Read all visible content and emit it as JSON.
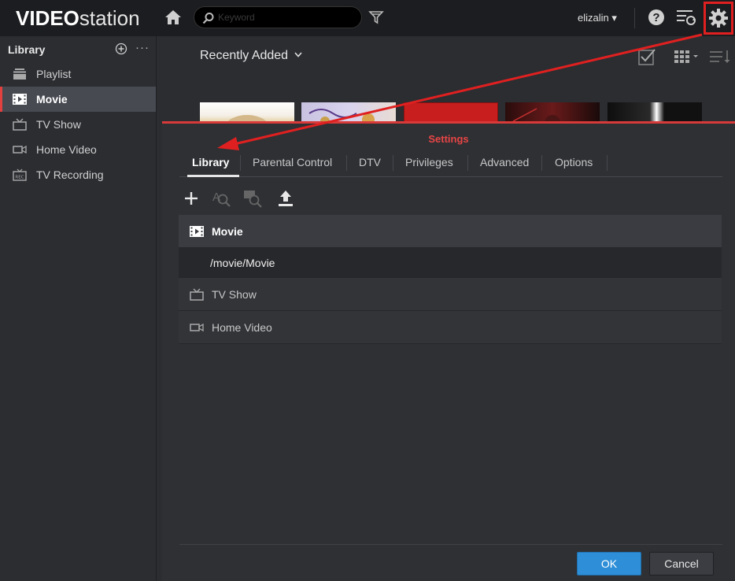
{
  "app": {
    "logo_bold": "VIDEO",
    "logo_light": "station"
  },
  "topbar": {
    "search_placeholder": "Keyword",
    "user": "elizalin ▾"
  },
  "sidebar": {
    "heading": "Library",
    "more": "···",
    "items": [
      {
        "label": "Playlist",
        "icon": "playlist-icon",
        "active": false
      },
      {
        "label": "Movie",
        "icon": "film-icon",
        "active": true
      },
      {
        "label": "TV Show",
        "icon": "tv-icon",
        "active": false
      },
      {
        "label": "Home Video",
        "icon": "camcorder-icon",
        "active": false
      },
      {
        "label": "TV Recording",
        "icon": "rec-icon",
        "active": false
      }
    ]
  },
  "content": {
    "title": "Recently Added"
  },
  "settings": {
    "title": "Settings",
    "tabs": [
      {
        "label": "Library",
        "active": true
      },
      {
        "label": "Parental Control",
        "active": false
      },
      {
        "label": "DTV",
        "active": false
      },
      {
        "label": "Privileges",
        "active": false
      },
      {
        "label": "Advanced",
        "active": false
      },
      {
        "label": "Options",
        "active": false
      }
    ],
    "library": {
      "movie": "Movie",
      "movie_folder": "/movie/Movie",
      "tvshow": "TV Show",
      "homevideo": "Home Video"
    },
    "ok": "OK",
    "cancel": "Cancel"
  },
  "colors": {
    "accent_red": "#e34040",
    "ok_blue": "#2e8fd8",
    "annotation_red": "#e02020"
  }
}
